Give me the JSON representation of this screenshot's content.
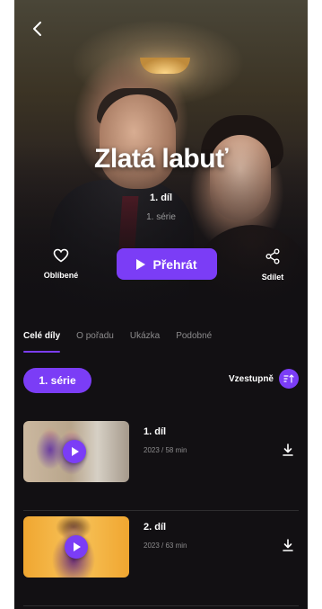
{
  "show": {
    "title": "Zlatá labuť",
    "episode": "1. díl",
    "season": "1. série"
  },
  "actions": {
    "favorite_label": "Oblíbené",
    "play_label": "Přehrát",
    "share_label": "Sdílet"
  },
  "tabs": [
    {
      "label": "Celé díly",
      "active": true
    },
    {
      "label": "O pořadu",
      "active": false
    },
    {
      "label": "Ukázka",
      "active": false
    },
    {
      "label": "Podobné",
      "active": false
    }
  ],
  "season_selector": "1. série",
  "sort_label": "Vzestupně",
  "episodes": [
    {
      "title": "1. díl",
      "meta": "2023 / 58 min"
    },
    {
      "title": "2. díl",
      "meta": "2023 / 63 min"
    }
  ],
  "colors": {
    "accent": "#7b3df6",
    "background": "#121013"
  },
  "icons": [
    "back-arrow-icon",
    "heart-icon",
    "play-icon",
    "share-icon",
    "sort-icon",
    "download-icon"
  ]
}
